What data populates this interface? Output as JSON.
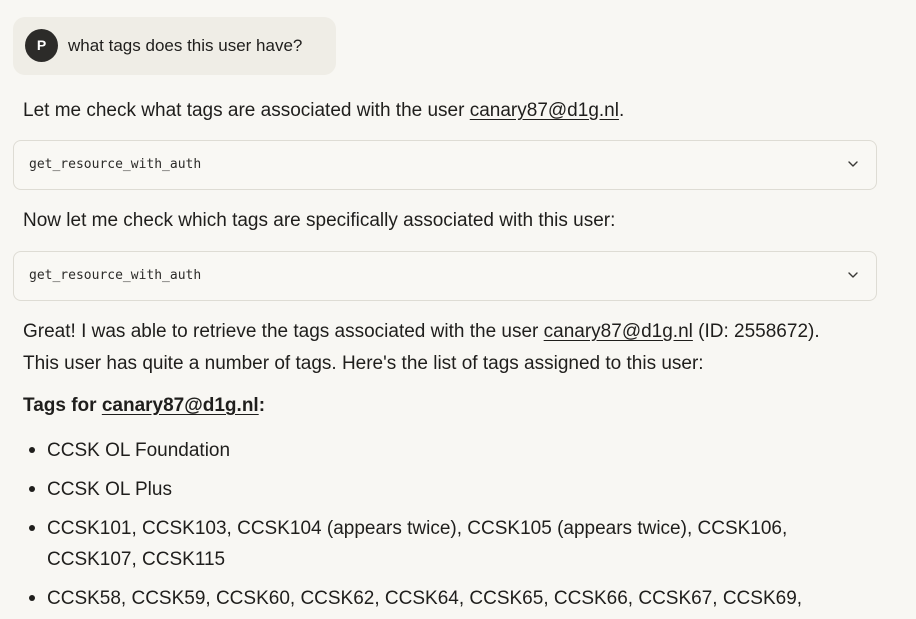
{
  "user_message": {
    "avatar_initial": "P",
    "text": "what tags does this user have?"
  },
  "assistant": {
    "intro": {
      "before": "Let me check what tags are associated with the user ",
      "email": "canary87@d1g.nl",
      "after": "."
    },
    "tool_call_1": {
      "name": "get_resource_with_auth",
      "icon": "chevron-down-icon"
    },
    "followup": "Now let me check which tags are specifically associated with this user:",
    "tool_call_2": {
      "name": "get_resource_with_auth",
      "icon": "chevron-down-icon"
    },
    "result": {
      "line1_before": "Great! I was able to retrieve the tags associated with the user ",
      "email": "canary87@d1g.nl",
      "line1_after": " (ID: 2558672).",
      "line2": "This user has quite a number of tags. Here's the list of tags assigned to this user:"
    },
    "tags_heading": {
      "before": "Tags for ",
      "email": "canary87@d1g.nl",
      "after": ":"
    },
    "tag_items": [
      {
        "line1": "CCSK OL Foundation"
      },
      {
        "line1": "CCSK OL Plus"
      },
      {
        "line1": "CCSK101, CCSK103, CCSK104 (appears twice), CCSK105 (appears twice), CCSK106,",
        "line2": "CCSK107, CCSK115"
      },
      {
        "line1": "CCSK58, CCSK59, CCSK60, CCSK62, CCSK64, CCSK65, CCSK66, CCSK67, CCSK69,"
      }
    ]
  }
}
